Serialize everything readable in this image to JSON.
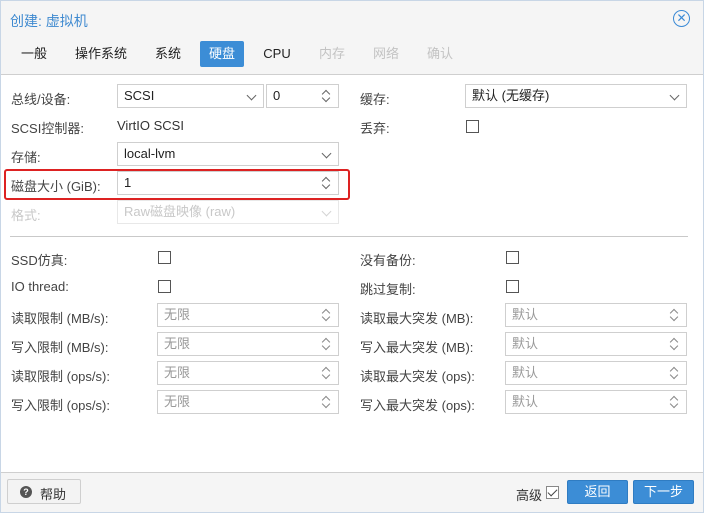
{
  "window": {
    "title": "创建: 虚拟机"
  },
  "tabs": [
    {
      "label": "一般",
      "state": "normal"
    },
    {
      "label": "操作系统",
      "state": "normal"
    },
    {
      "label": "系统",
      "state": "normal"
    },
    {
      "label": "硬盘",
      "state": "active"
    },
    {
      "label": "CPU",
      "state": "normal"
    },
    {
      "label": "内存",
      "state": "disabled"
    },
    {
      "label": "网络",
      "state": "disabled"
    },
    {
      "label": "确认",
      "state": "disabled"
    }
  ],
  "form": {
    "bus_device": {
      "label": "总线/设备:",
      "bus_value": "SCSI",
      "device_value": "0"
    },
    "scsi_controller": {
      "label": "SCSI控制器:",
      "value": "VirtIO SCSI"
    },
    "storage": {
      "label": "存储:",
      "value": "local-lvm"
    },
    "disk_size": {
      "label": "磁盘大小 (GiB):",
      "value": "1"
    },
    "format": {
      "label": "格式:",
      "value": "Raw磁盘映像 (raw)"
    },
    "cache": {
      "label": "缓存:",
      "value": "默认 (无缓存)"
    },
    "discard": {
      "label": "丢弃:",
      "checked": false
    }
  },
  "advanced": {
    "ssd_emulation": {
      "label": "SSD仿真:",
      "checked": false
    },
    "io_thread": {
      "label": "IO thread:",
      "checked": false
    },
    "no_backup": {
      "label": "没有备份:",
      "checked": false
    },
    "skip_replication": {
      "label": "跳过复制:",
      "checked": false
    },
    "read_limit_mb": {
      "label": "读取限制 (MB/s):",
      "placeholder": "无限"
    },
    "write_limit_mb": {
      "label": "写入限制 (MB/s):",
      "placeholder": "无限"
    },
    "read_limit_ops": {
      "label": "读取限制 (ops/s):",
      "placeholder": "无限"
    },
    "write_limit_ops": {
      "label": "写入限制 (ops/s):",
      "placeholder": "无限"
    },
    "read_burst_mb": {
      "label": "读取最大突发 (MB):",
      "placeholder": "默认"
    },
    "write_burst_mb": {
      "label": "写入最大突发 (MB):",
      "placeholder": "默认"
    },
    "read_burst_ops": {
      "label": "读取最大突发 (ops):",
      "placeholder": "默认"
    },
    "write_burst_ops": {
      "label": "写入最大突发 (ops):",
      "placeholder": "默认"
    }
  },
  "footer": {
    "help_label": "帮助",
    "advanced_label": "高级",
    "advanced_checked": true,
    "back_label": "返回",
    "next_label": "下一步"
  },
  "colors": {
    "accent": "#3c8dd6",
    "highlight_border": "#dd2222",
    "title": "#3f8ad0"
  }
}
